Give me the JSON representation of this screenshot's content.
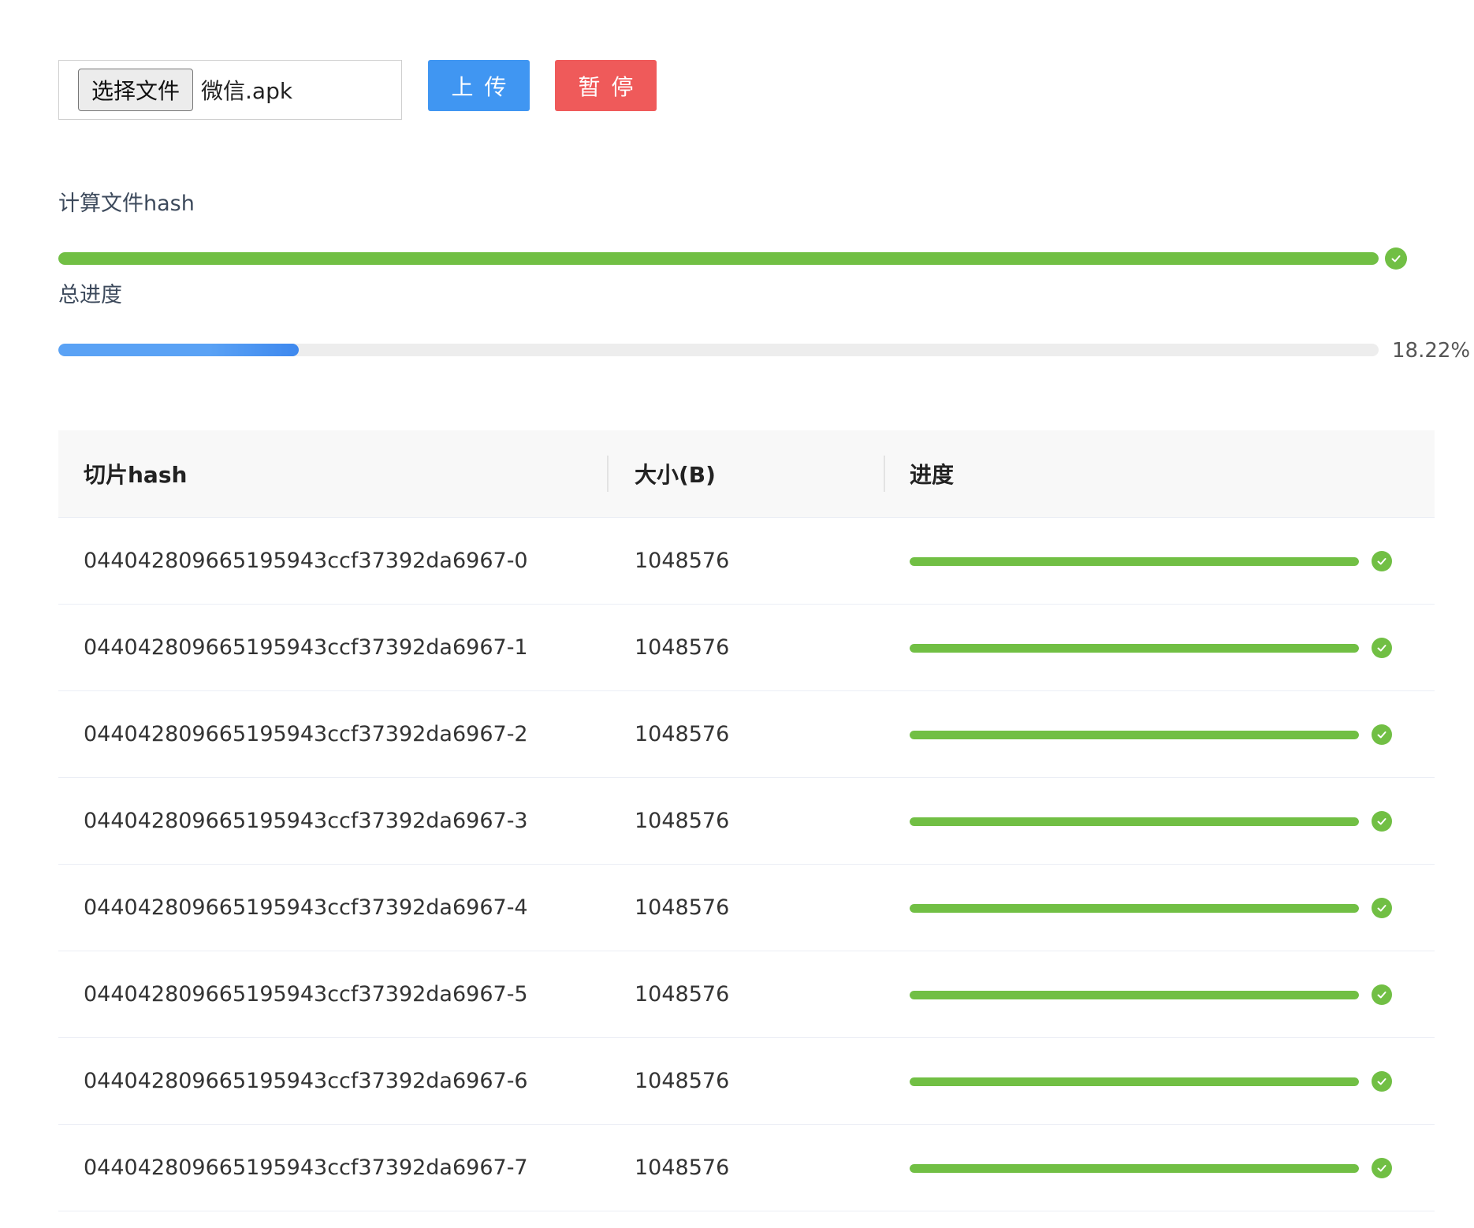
{
  "file_input": {
    "button_label": "选择文件",
    "file_name": "微信.apk"
  },
  "buttons": {
    "upload_label": "上传",
    "pause_label": "暂停"
  },
  "hash_progress": {
    "label": "计算文件hash",
    "percent": 100,
    "status": "success"
  },
  "total_progress": {
    "label": "总进度",
    "percent": 18.22,
    "percent_text": "18.22%"
  },
  "colors": {
    "primary": "#4096f2",
    "danger": "#ef5a5a",
    "success": "#71bf44"
  },
  "table": {
    "headers": [
      "切片hash",
      "大小(B)",
      "进度"
    ],
    "rows": [
      {
        "hash": "044042809665195943ccf37392da6967-0",
        "size": "1048576",
        "progress": 100
      },
      {
        "hash": "044042809665195943ccf37392da6967-1",
        "size": "1048576",
        "progress": 100
      },
      {
        "hash": "044042809665195943ccf37392da6967-2",
        "size": "1048576",
        "progress": 100
      },
      {
        "hash": "044042809665195943ccf37392da6967-3",
        "size": "1048576",
        "progress": 100
      },
      {
        "hash": "044042809665195943ccf37392da6967-4",
        "size": "1048576",
        "progress": 100
      },
      {
        "hash": "044042809665195943ccf37392da6967-5",
        "size": "1048576",
        "progress": 100
      },
      {
        "hash": "044042809665195943ccf37392da6967-6",
        "size": "1048576",
        "progress": 100
      },
      {
        "hash": "044042809665195943ccf37392da6967-7",
        "size": "1048576",
        "progress": 100
      }
    ]
  }
}
